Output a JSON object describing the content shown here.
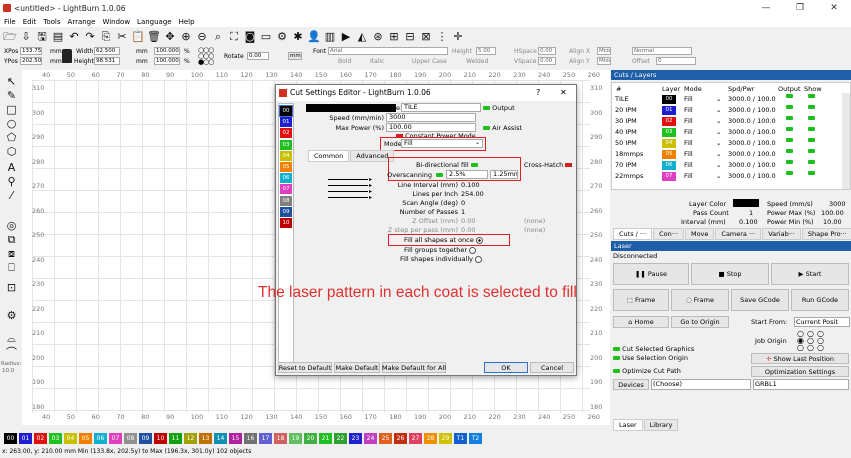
{
  "app": {
    "title": "<untitled> - LightBurn 1.0.06"
  },
  "window_controls": {
    "minimize": "—",
    "restore": "❐",
    "close": "✕"
  },
  "menu": [
    "File",
    "Edit",
    "Tools",
    "Arrange",
    "Window",
    "Language",
    "Help"
  ],
  "toolbar_icons": [
    "open-file-icon",
    "import-icon",
    "save-icon",
    "save-as-icon",
    "undo-icon",
    "redo-icon",
    "copy-icon",
    "cut-icon",
    "paste-icon",
    "delete-icon",
    "move-icon",
    "zoom-in-icon",
    "zoom-out-icon",
    "zoom-fit-icon",
    "frame-icon",
    "camera-icon",
    "monitor-icon",
    "settings-icon",
    "tools-icon",
    "user-icon",
    "print-icon",
    "align-icon",
    "mirror-icon",
    "target-icon",
    "group-icon",
    "ungroup-icon",
    "weld-icon",
    "distribute-icon",
    "plus-grid-icon"
  ],
  "coords": {
    "xpos_label": "XPos",
    "xpos": "133.750",
    "ypos_label": "YPos",
    "ypos": "202.500",
    "unit": "mm",
    "width_label": "Width",
    "width": "62.500",
    "height_label": "Height",
    "height": "98.531",
    "unit2": "mm",
    "scale_w": "100.000",
    "scale_h": "100.000",
    "pct": "%",
    "rotate_label": "Rotate",
    "rotate": "0.00",
    "mm_button": "mm",
    "font_label": "Font",
    "font": "Arial",
    "height2_label": "Height",
    "height2": "5.00",
    "hspace_label": "HSpace",
    "hspace": "0.00",
    "vspace_label": "VSpace",
    "vspace": "0.00",
    "align_x_label": "Align X",
    "align_x": "Middle",
    "align_y_label": "Align Y",
    "align_y": "Middle",
    "normal": "Normal",
    "offset_label": "Offset",
    "offset": "0",
    "bold": "Bold",
    "italic": "Italic",
    "upper": "Upper Case",
    "welded": "Welded"
  },
  "ruler": {
    "top": [
      "40",
      "50",
      "60",
      "70",
      "80",
      "90",
      "100",
      "110",
      "120",
      "130",
      "140",
      "150",
      "160",
      "170",
      "180",
      "190",
      "200",
      "210",
      "220",
      "230",
      "240",
      "250",
      "260"
    ],
    "left": [
      "310",
      "300",
      "290",
      "280",
      "270",
      "260",
      "250",
      "240",
      "230",
      "220",
      "210",
      "200",
      "190",
      "180"
    ],
    "right": [
      "310",
      "300",
      "290",
      "280",
      "270",
      "260",
      "250",
      "240",
      "230",
      "220",
      "210",
      "200",
      "190",
      "180"
    ]
  },
  "left_tools": [
    "select-icon",
    "edit-nodes-icon",
    "rectangle-icon",
    "ellipse-icon",
    "polygon-icon",
    "polygon2-icon",
    "text-icon",
    "position-icon",
    "measure-icon",
    "offset-icon",
    "array-icon",
    "copy-along-icon",
    "align-icon",
    "grid-icon",
    "settings-gear-icon",
    "shape-icon",
    "shape2-icon"
  ],
  "radius": {
    "label": "Radius:",
    "value": "10.0"
  },
  "layers_panel": {
    "title": "Cuts / Layers",
    "headers": [
      "#",
      "Layer",
      "Mode",
      "Spd/Pwr",
      "Output",
      "Show"
    ],
    "rows": [
      {
        "name": "TILE",
        "layer": "00",
        "color": "#000000",
        "mode": "Fill",
        "spd": "3000.0 / 100.0"
      },
      {
        "name": "20 IPM",
        "layer": "01",
        "color": "#1f1fd0",
        "mode": "Fill",
        "spd": "3000.0 / 100.0"
      },
      {
        "name": "30 IPM",
        "layer": "02",
        "color": "#e01010",
        "mode": "Fill",
        "spd": "3000.0 / 100.0"
      },
      {
        "name": "40 IPM",
        "layer": "03",
        "color": "#20c020",
        "mode": "Fill",
        "spd": "3000.0 / 100.0"
      },
      {
        "name": "50 IPM",
        "layer": "04",
        "color": "#c8c000",
        "mode": "Fill",
        "spd": "3000.0 / 100.0"
      },
      {
        "name": "18mmps",
        "layer": "05",
        "color": "#f08000",
        "mode": "Fill",
        "spd": "3000.0 / 100.0"
      },
      {
        "name": "70 IPM",
        "layer": "06",
        "color": "#10b0d0",
        "mode": "Fill",
        "spd": "3000.0 / 100.0"
      },
      {
        "name": "22mmps",
        "layer": "07",
        "color": "#e040c0",
        "mode": "Fill",
        "spd": "3000.0 / 100.0"
      }
    ],
    "layer_color_label": "Layer Color",
    "speed_label": "Speed (mm/s)",
    "speed": "3000",
    "pass_count_label": "Pass Count",
    "pass_count": "1",
    "power_max_label": "Power Max (%)",
    "power_max": "100.00",
    "interval_label": "Interval (mm)",
    "interval": "0.100",
    "power_min_label": "Power Min (%)",
    "power_min": "10.00",
    "tabs": [
      "Cuts / ···",
      "Con···",
      "Move",
      "Camera ···",
      "Variab···",
      "Shape Pro···"
    ]
  },
  "laser_panel": {
    "title": "Laser",
    "status": "Disconnected",
    "pause": "Pause",
    "stop": "Stop",
    "start": "Start",
    "frame1": "Frame",
    "frame2": "Frame",
    "save_gcode": "Save GCode",
    "run_gcode": "Run GCode",
    "home": "Home",
    "go_to_origin": "Go to Origin",
    "start_from_label": "Start From:",
    "start_from": "Current Posit",
    "job_origin_label": "Job Origin",
    "cut_selected": "Cut Selected Graphics",
    "use_selection_origin": "Use Selection Origin",
    "show_last_position": "Show Last Position",
    "optimize_cut_path": "Optimize Cut Path",
    "optimization_settings": "Optimization Settings",
    "devices": "Devices",
    "choose": "(Choose)",
    "device": "GRBL1",
    "bottom_tabs": [
      "Laser",
      "Library"
    ]
  },
  "dialog": {
    "title": "Cut Settings Editor - LightBurn 1.0.06",
    "help": "?",
    "close": "✕",
    "name_label": "Name",
    "name": "TILE",
    "output_label": "Output",
    "speed_label": "Speed (mm/min)",
    "speed": "3000",
    "max_power_label": "Max Power (%)",
    "max_power": "100.00",
    "air_assist_label": "Air Assist",
    "constant_power": "Constant Power Mode",
    "mode_label": "Mode",
    "mode": "Fill",
    "tabs": [
      "Common",
      "Advanced"
    ],
    "bidir": "Bi-directional fill",
    "crosshatch": "Cross-Hatch",
    "overscanning_label": "Overscanning",
    "overscan_pct": "2.5%",
    "overscan_mm": "1.25mm",
    "line_interval_label": "Line Interval (mm)",
    "line_interval": "0.100",
    "lpi_label": "Lines per Inch",
    "lpi": "254.00",
    "scan_angle_label": "Scan Angle (deg)",
    "scan_angle": "0",
    "passes_label": "Number of Passes",
    "passes": "1",
    "z_offset_label": "Z Offset (mm)",
    "z_offset": "0.00",
    "z_offset_none": "(none)",
    "z_step_label": "Z step per pass (mm)",
    "z_step": "0.00",
    "z_step_none": "(none)",
    "fill_all": "Fill all shapes at once",
    "fill_groups": "Fill groups together",
    "fill_individually": "Fill shapes individually",
    "reset": "Reset to Default",
    "make_default": "Make Default",
    "make_default_all": "Make Default for All",
    "ok": "OK",
    "cancel": "Cancel",
    "layers": [
      {
        "id": "00",
        "color": "#000000"
      },
      {
        "id": "01",
        "color": "#1f1fd0"
      },
      {
        "id": "02",
        "color": "#e01010"
      },
      {
        "id": "03",
        "color": "#20c020"
      },
      {
        "id": "04",
        "color": "#c8c000"
      },
      {
        "id": "05",
        "color": "#f08000"
      },
      {
        "id": "06",
        "color": "#10b0d0"
      },
      {
        "id": "07",
        "color": "#e040c0"
      },
      {
        "id": "08",
        "color": "#808080"
      },
      {
        "id": "09",
        "color": "#1f4f9f"
      },
      {
        "id": "10",
        "color": "#c00000"
      }
    ]
  },
  "annotation": "The laser pattern in each coat is selected to fill",
  "palette": [
    {
      "id": "00",
      "c": "#000000"
    },
    {
      "id": "01",
      "c": "#1f1fd0"
    },
    {
      "id": "02",
      "c": "#e01010"
    },
    {
      "id": "03",
      "c": "#20c020"
    },
    {
      "id": "04",
      "c": "#c8c000"
    },
    {
      "id": "05",
      "c": "#f08000"
    },
    {
      "id": "06",
      "c": "#10b0d0"
    },
    {
      "id": "07",
      "c": "#e040c0"
    },
    {
      "id": "08",
      "c": "#909090"
    },
    {
      "id": "09",
      "c": "#1f4f9f"
    },
    {
      "id": "10",
      "c": "#c00000"
    },
    {
      "id": "11",
      "c": "#10a010"
    },
    {
      "id": "12",
      "c": "#a0a000"
    },
    {
      "id": "13",
      "c": "#c07000"
    },
    {
      "id": "14",
      "c": "#1090b0"
    },
    {
      "id": "15",
      "c": "#b020a0"
    },
    {
      "id": "16",
      "c": "#707070"
    },
    {
      "id": "17",
      "c": "#6060d0"
    },
    {
      "id": "18",
      "c": "#d06060"
    },
    {
      "id": "19",
      "c": "#60c060"
    },
    {
      "id": "20",
      "c": "#40b040"
    },
    {
      "id": "21",
      "c": "#20c020"
    },
    {
      "id": "22",
      "c": "#30a030"
    },
    {
      "id": "23",
      "c": "#2020d0"
    },
    {
      "id": "24",
      "c": "#c040c0"
    },
    {
      "id": "25",
      "c": "#e06020"
    },
    {
      "id": "26",
      "c": "#c03010"
    },
    {
      "id": "27",
      "c": "#e04060"
    },
    {
      "id": "28",
      "c": "#f09000"
    },
    {
      "id": "29",
      "c": "#d0c000"
    },
    {
      "id": "T1",
      "c": "#1060d0"
    },
    {
      "id": "T2",
      "c": "#1080e0"
    }
  ],
  "status": "x: 263.00, y: 210.00 mm     Min (133.8x, 202.5y) to Max (196.3x, 301.0y)  102 objects"
}
